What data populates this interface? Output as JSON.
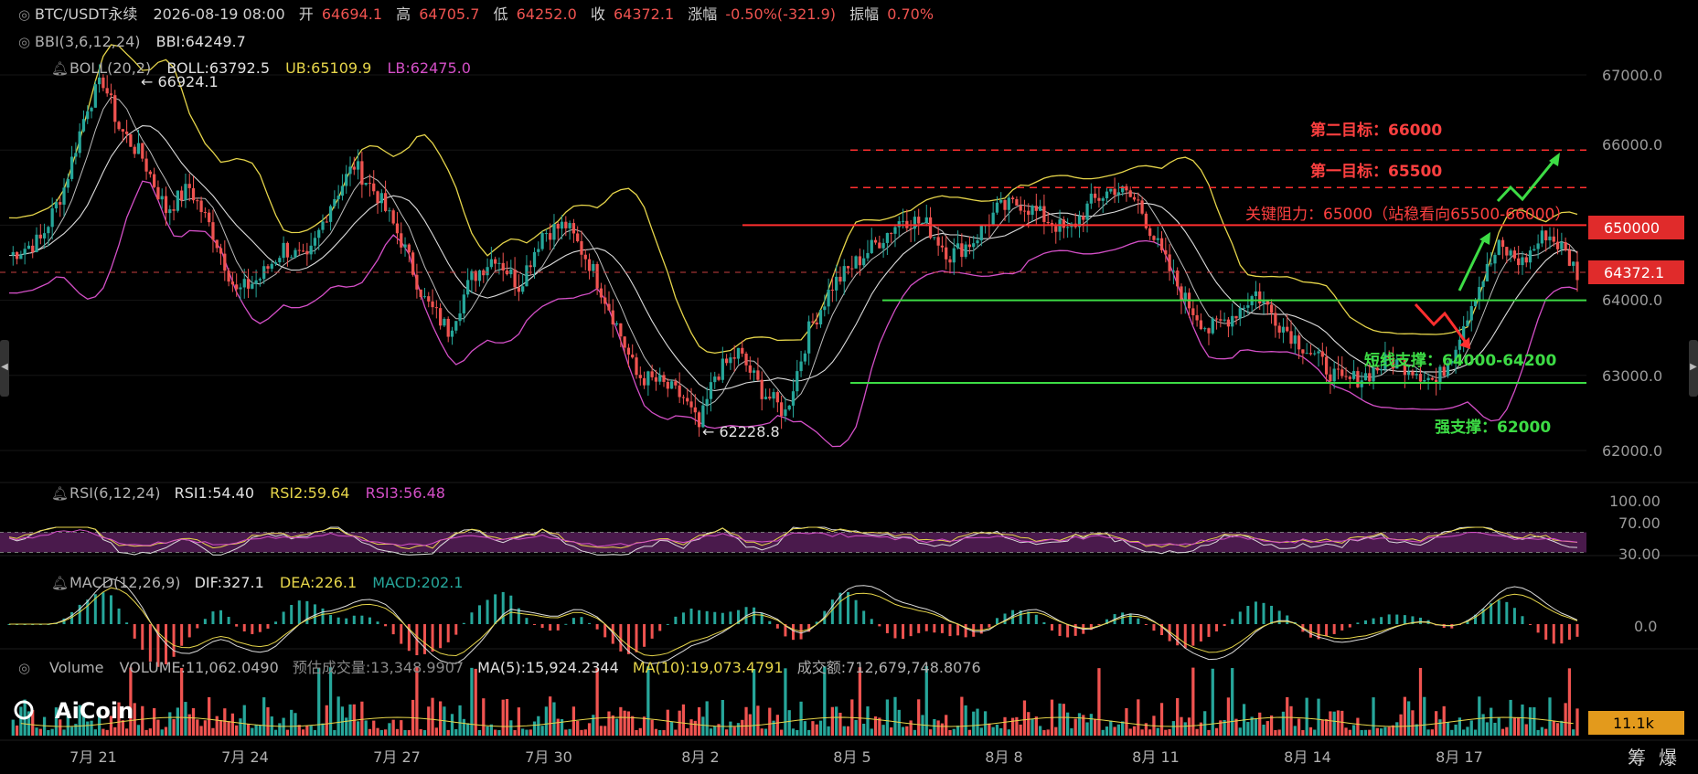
{
  "header": {
    "symbol": "BTC/USDT永续",
    "datetime": "2026-08-19 08:00",
    "open_label": "开",
    "open": "64694.1",
    "high_label": "高",
    "high": "64705.7",
    "low_label": "低",
    "low": "64252.0",
    "close_label": "收",
    "close": "64372.1",
    "change_label": "涨幅",
    "change": "-0.50%(-321.9)",
    "amp_label": "振幅",
    "amp": "0.70%"
  },
  "indicators": {
    "bbi": {
      "name": "BBI(3,6,12,24)",
      "value": "BBI:64249.7"
    },
    "boll": {
      "name": "BOLL(20,2)",
      "mid": "BOLL:63792.5",
      "ub": "UB:65109.9",
      "lb": "LB:62475.0"
    },
    "rsi": {
      "name": "RSI(6,12,24)",
      "rsi1": "RSI1:54.40",
      "rsi2": "RSI2:59.64",
      "rsi3": "RSI3:56.48"
    },
    "macd": {
      "name": "MACD(12,26,9)",
      "dif": "DIF:327.1",
      "dea": "DEA:226.1",
      "macd": "MACD:202.1"
    },
    "volume": {
      "name": "Volume",
      "vol": "VOLUME:11,062.0490",
      "est": "预估成交量:13,348.9907",
      "ma5": "MA(5):15,924.2344",
      "ma10": "MA(10):19,073.4791",
      "amount": "成交额:712,679,748.8076"
    }
  },
  "annotations": {
    "high_marker": "← 66924.1",
    "low_marker": "← 62228.8",
    "target2": "第二目标：66000",
    "target1": "第一目标：65500",
    "resistance": "关键阻力：65000（站稳看向65500-66000）",
    "short_support": "短线支撑：64000-64200",
    "strong_support": "强支撑：62000"
  },
  "price_axis": {
    "ticks": [
      "67000.0",
      "66000.0",
      "65000.0",
      "64000.0",
      "63000.0",
      "62000.0"
    ],
    "resistance_tag": "650000",
    "current_tag": "64372.1"
  },
  "rsi_axis": [
    "100.00",
    "70.00",
    "30.00"
  ],
  "macd_axis": [
    "0.0"
  ],
  "volume_axis": {
    "tag": "11.1k"
  },
  "time_axis": [
    "7月 21",
    "7月 24",
    "7月 27",
    "7月 30",
    "8月 2",
    "8月 5",
    "8月 8",
    "8月 11",
    "8月 14",
    "8月 17"
  ],
  "brand": {
    "logo_text": "AiCoin"
  },
  "corner": {
    "chips": "筹",
    "boom": "爆"
  },
  "colors": {
    "up": "#26a69a",
    "down": "#ef5350",
    "boll_ub": "#e6d54a",
    "boll_lb": "#d44fc7",
    "resistance": "#ff2f2f",
    "support": "#3ddc45",
    "rsi_band": "#4a1a4c"
  },
  "chart_data": {
    "type": "candlestick",
    "interval": "4h",
    "x_range": [
      "7月 19",
      "8月 19"
    ],
    "ylim": [
      61500,
      67500
    ],
    "key_levels": {
      "target2": 66000,
      "target1": 65500,
      "resistance": 65000,
      "current": 64372.1,
      "support_short_top": 64000,
      "support_line": 62900,
      "strong_support": 62000
    },
    "price_path": [
      [
        0,
        64600
      ],
      [
        8,
        64800
      ],
      [
        14,
        65500
      ],
      [
        20,
        66600
      ],
      [
        24,
        66924
      ],
      [
        28,
        66300
      ],
      [
        34,
        65900
      ],
      [
        40,
        65200
      ],
      [
        46,
        65500
      ],
      [
        52,
        64900
      ],
      [
        58,
        64100
      ],
      [
        64,
        64300
      ],
      [
        70,
        64700
      ],
      [
        76,
        64500
      ],
      [
        82,
        65300
      ],
      [
        88,
        65800
      ],
      [
        94,
        65400
      ],
      [
        100,
        64800
      ],
      [
        106,
        64000
      ],
      [
        112,
        63600
      ],
      [
        118,
        64300
      ],
      [
        124,
        64600
      ],
      [
        130,
        64200
      ],
      [
        136,
        64900
      ],
      [
        142,
        65000
      ],
      [
        148,
        64500
      ],
      [
        154,
        63800
      ],
      [
        160,
        63000
      ],
      [
        166,
        62900
      ],
      [
        172,
        62700
      ],
      [
        176,
        62300
      ],
      [
        180,
        63000
      ],
      [
        186,
        63300
      ],
      [
        192,
        62800
      ],
      [
        198,
        62500
      ],
      [
        204,
        63600
      ],
      [
        210,
        64200
      ],
      [
        216,
        64500
      ],
      [
        222,
        64800
      ],
      [
        228,
        65100
      ],
      [
        234,
        65000
      ],
      [
        240,
        64600
      ],
      [
        246,
        64800
      ],
      [
        252,
        65200
      ],
      [
        258,
        65300
      ],
      [
        264,
        65100
      ],
      [
        270,
        64900
      ],
      [
        276,
        65300
      ],
      [
        282,
        65500
      ],
      [
        288,
        65300
      ],
      [
        294,
        64600
      ],
      [
        300,
        64000
      ],
      [
        306,
        63600
      ],
      [
        312,
        63800
      ],
      [
        318,
        64100
      ],
      [
        324,
        63700
      ],
      [
        330,
        63400
      ],
      [
        336,
        63100
      ],
      [
        340,
        62900
      ],
      [
        346,
        63000
      ],
      [
        352,
        63200
      ],
      [
        358,
        63100
      ],
      [
        364,
        62900
      ],
      [
        368,
        63300
      ],
      [
        374,
        64100
      ],
      [
        380,
        64700
      ],
      [
        386,
        64500
      ],
      [
        392,
        64900
      ],
      [
        396,
        64700
      ],
      [
        400,
        64372
      ]
    ],
    "rsi_series": [
      {
        "name": "RSI1",
        "level": 54.4
      },
      {
        "name": "RSI2",
        "level": 59.64
      },
      {
        "name": "RSI3",
        "level": 56.48
      }
    ],
    "macd_series": {
      "dif": 327.1,
      "dea": 226.1,
      "hist": 202.1
    },
    "volume": {
      "last": 11062.049,
      "ma5": 15924.2344,
      "ma10": 19073.4791
    }
  }
}
